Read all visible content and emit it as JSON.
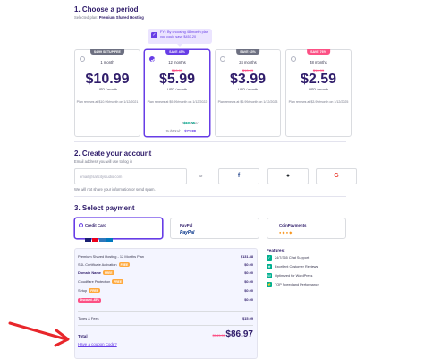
{
  "period": {
    "heading": "1. Choose a period",
    "selected_prefix": "Selected plan:",
    "selected_plan": "Premium Shared Hosting",
    "fyi": "FYI: By choosing 48 month plan you could save $453.20",
    "plans": [
      {
        "badge": "$4.99 SETUP FEE",
        "term": "1 month",
        "old_price": "",
        "price": "$10.99",
        "unit": "USD / month",
        "renew": "Plan renews at $10.99/month on 1/12/2021"
      },
      {
        "badge": "SAVE 45%",
        "term": "12 months",
        "old_price": "$10.99",
        "price": "$5.99",
        "unit": "USD / month",
        "renew": "Plan renews at $9.99/month on 1/12/2022"
      },
      {
        "badge": "SAVE 63%",
        "term": "24 months",
        "old_price": "$10.99",
        "price": "$3.99",
        "unit": "USD / month",
        "renew": "Plan renews at $6.99/month on 1/12/2023"
      },
      {
        "badge": "SAVE 76%",
        "term": "48 months",
        "old_price": "$10.99",
        "price": "$2.59",
        "unit": "USD / month",
        "renew": "Plan renews at $3.99/month on 1/12/2025"
      }
    ],
    "you_save_label": "You save:",
    "you_save_value": "$60.00",
    "subtotal_label": "Subtotal:",
    "subtotal_value": "$71.88"
  },
  "account": {
    "heading": "2. Create your account",
    "hint": "Email address you will use to log in",
    "email_placeholder": "email@saltcitystudio.com",
    "privacy": "We will not share your information or send spam.",
    "or": "or",
    "social": [
      {
        "name": "facebook",
        "glyph": "f",
        "color": "#3b5998"
      },
      {
        "name": "github",
        "glyph": "●",
        "color": "#24292e"
      },
      {
        "name": "google",
        "glyph": "G",
        "color": "#ea4335"
      }
    ]
  },
  "payment": {
    "heading": "3. Select payment",
    "methods": [
      {
        "label": "Credit Card"
      },
      {
        "label": "PayPal",
        "logo": "PayPal"
      },
      {
        "label": "CoinPayments"
      }
    ]
  },
  "summary": {
    "rows": [
      {
        "label": "Premium Shared Hosting - 12 Months Plan",
        "value": "$131.88"
      },
      {
        "label": "SSL Certificate Activation",
        "tag": "FREE",
        "value": "$0.00"
      },
      {
        "label": "Domain Name",
        "tag": "FREE",
        "value": "$0.00"
      },
      {
        "label": "Cloudflare Protection",
        "tag": "FREE",
        "value": "$0.00"
      },
      {
        "label": "Setup",
        "tag": "FREE",
        "value": "$0.00"
      },
      {
        "label": "Discount -45%",
        "value": "$0.00"
      }
    ],
    "taxes_label": "Taxes & Fees",
    "taxes_value": "$15.09",
    "total_label": "Total",
    "total_old": "$149.97",
    "total_value": "$86.97",
    "coupon": "Have a coupon Code?"
  },
  "features": {
    "heading": "Features:",
    "items": [
      "24/7/365 Chat Support",
      "Excellent Customer Reviews",
      "Optimized for WordPress",
      "TOP Speed and Performance"
    ]
  },
  "colors": {
    "accent": "#673de6",
    "arrow": "#e8262b",
    "pink": "#fc5185"
  }
}
